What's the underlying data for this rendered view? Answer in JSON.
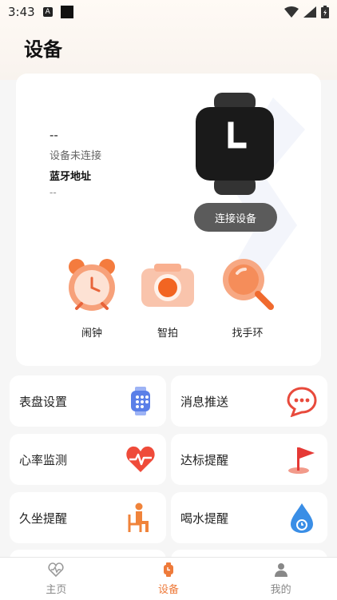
{
  "status": {
    "time": "3:43"
  },
  "header": {
    "title": "设备"
  },
  "device": {
    "name": "--",
    "status": "设备未连接",
    "bluetooth_label": "蓝牙地址",
    "bluetooth_value": "--",
    "connect_label": "连接设备"
  },
  "quick_actions": [
    {
      "label": "闹钟",
      "icon": "alarm-clock-icon"
    },
    {
      "label": "智拍",
      "icon": "camera-icon"
    },
    {
      "label": "找手环",
      "icon": "magnifier-icon"
    }
  ],
  "features": [
    {
      "label": "表盘设置",
      "icon": "watch-face-icon"
    },
    {
      "label": "消息推送",
      "icon": "message-bubble-icon"
    },
    {
      "label": "心率监测",
      "icon": "heart-rate-icon"
    },
    {
      "label": "达标提醒",
      "icon": "flag-icon"
    },
    {
      "label": "久坐提醒",
      "icon": "sitting-person-icon"
    },
    {
      "label": "喝水提醒",
      "icon": "water-drop-icon"
    }
  ],
  "tabs": [
    {
      "label": "主页",
      "icon": "home-heart-icon"
    },
    {
      "label": "设备",
      "icon": "device-watch-icon"
    },
    {
      "label": "我的",
      "icon": "profile-icon"
    }
  ],
  "colors": {
    "accent": "#ee7a3a",
    "connect_button": "#5b5b5b"
  }
}
